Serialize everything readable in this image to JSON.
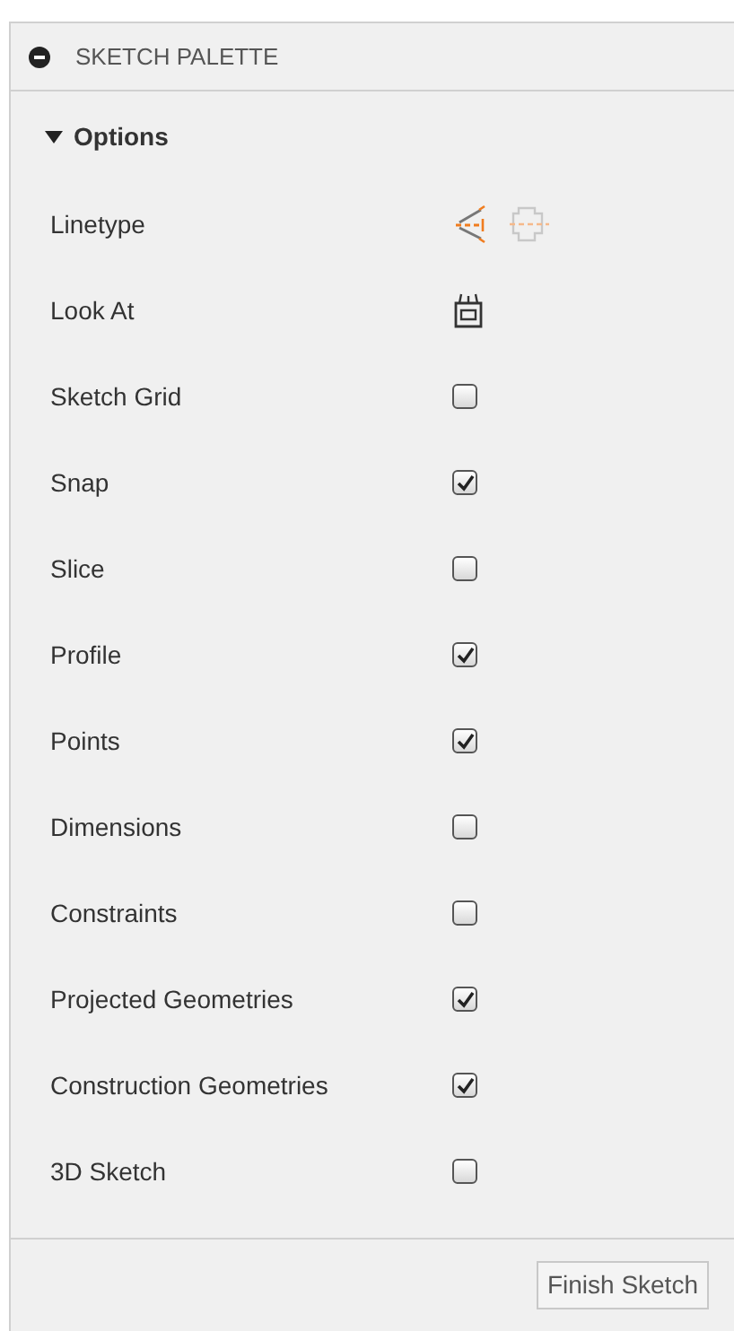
{
  "palette": {
    "title": "SKETCH PALETTE"
  },
  "section": {
    "title": "Options",
    "expanded": true
  },
  "rows": [
    {
      "kind": "linetype",
      "label": "Linetype"
    },
    {
      "kind": "look_at",
      "label": "Look At"
    },
    {
      "kind": "checkbox",
      "label": "Sketch Grid",
      "checked": false
    },
    {
      "kind": "checkbox",
      "label": "Snap",
      "checked": true
    },
    {
      "kind": "checkbox",
      "label": "Slice",
      "checked": false
    },
    {
      "kind": "checkbox",
      "label": "Profile",
      "checked": true
    },
    {
      "kind": "checkbox",
      "label": "Points",
      "checked": true
    },
    {
      "kind": "checkbox",
      "label": "Dimensions",
      "checked": false
    },
    {
      "kind": "checkbox",
      "label": "Constraints",
      "checked": false
    },
    {
      "kind": "checkbox",
      "label": "Projected Geometries",
      "checked": true
    },
    {
      "kind": "checkbox",
      "label": "Construction Geometries",
      "checked": true
    },
    {
      "kind": "checkbox",
      "label": "3D Sketch",
      "checked": false
    }
  ],
  "finish_button": "Finish Sketch"
}
